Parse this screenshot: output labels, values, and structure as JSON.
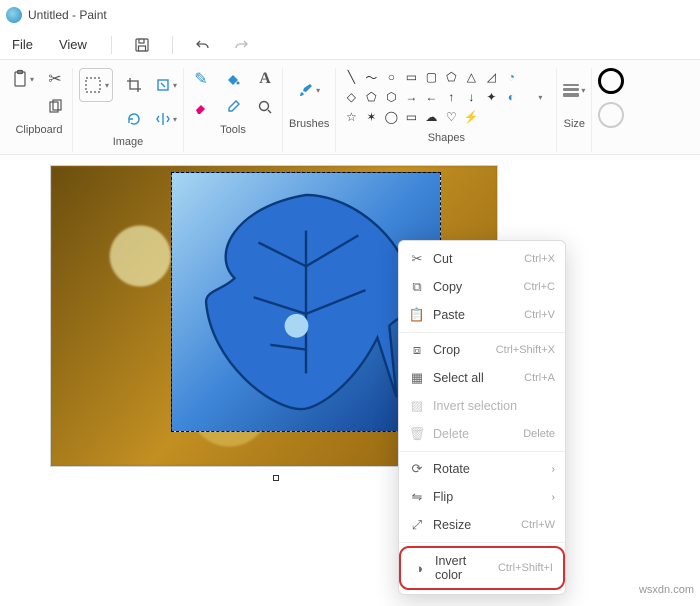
{
  "window": {
    "title": "Untitled - Paint"
  },
  "menu": {
    "file": "File",
    "view": "View"
  },
  "ribbon": {
    "clipboard": "Clipboard",
    "image": "Image",
    "tools": "Tools",
    "brushes": "Brushes",
    "shapes": "Shapes",
    "size": "Size"
  },
  "context": {
    "cut": {
      "label": "Cut",
      "shortcut": "Ctrl+X"
    },
    "copy": {
      "label": "Copy",
      "shortcut": "Ctrl+C"
    },
    "paste": {
      "label": "Paste",
      "shortcut": "Ctrl+V"
    },
    "crop": {
      "label": "Crop",
      "shortcut": "Ctrl+Shift+X"
    },
    "selectall": {
      "label": "Select all",
      "shortcut": "Ctrl+A"
    },
    "invertsel": {
      "label": "Invert selection",
      "shortcut": ""
    },
    "delete": {
      "label": "Delete",
      "shortcut": "Delete"
    },
    "rotate": {
      "label": "Rotate",
      "shortcut": ""
    },
    "flip": {
      "label": "Flip",
      "shortcut": ""
    },
    "resize": {
      "label": "Resize",
      "shortcut": "Ctrl+W"
    },
    "invertcol": {
      "label": "Invert color",
      "shortcut": "Ctrl+Shift+I"
    }
  },
  "watermark": "wsxdn.com"
}
